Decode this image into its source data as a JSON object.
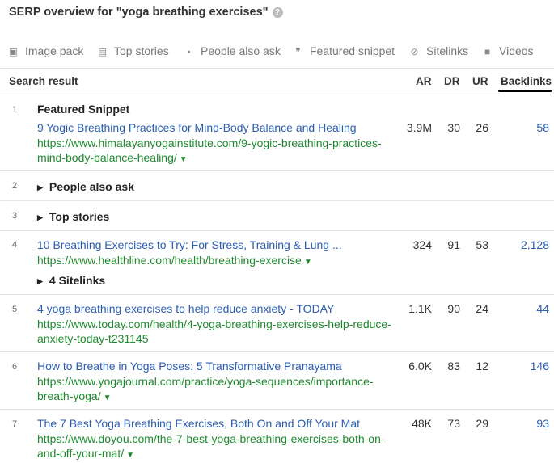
{
  "page_title": "SERP overview for \"yoga breathing exercises\"",
  "features": [
    {
      "icon": "image-icon",
      "glyph": "▣",
      "label": "Image pack"
    },
    {
      "icon": "news-icon",
      "glyph": "▤",
      "label": "Top stories"
    },
    {
      "icon": "question-icon",
      "glyph": "▪",
      "label": "People also ask"
    },
    {
      "icon": "quote-icon",
      "glyph": "❞",
      "label": "Featured snippet"
    },
    {
      "icon": "link-icon",
      "glyph": "⊘",
      "label": "Sitelinks"
    },
    {
      "icon": "video-icon",
      "glyph": "■",
      "label": "Videos"
    }
  ],
  "columns": {
    "result": "Search result",
    "ar": "AR",
    "dr": "DR",
    "ur": "UR",
    "backlinks": "Backlinks"
  },
  "rows": [
    {
      "num": "1",
      "heading": "Featured Snippet",
      "title": "9 Yogic Breathing Practices for Mind-Body Balance and Healing",
      "url": "https://www.himalayanyogainstitute.com/9-yogic-breathing-practices-mind-body-balance-healing/",
      "ar": "3.9M",
      "dr": "30",
      "ur": "26",
      "backlinks": "58"
    },
    {
      "num": "2",
      "label": "People also ask"
    },
    {
      "num": "3",
      "label": "Top stories"
    },
    {
      "num": "4",
      "title": "10 Breathing Exercises to Try: For Stress, Training & Lung ...",
      "url": "https://www.healthline.com/health/breathing-exercise",
      "sitelinks": "4 Sitelinks",
      "ar": "324",
      "dr": "91",
      "ur": "53",
      "backlinks": "2,128"
    },
    {
      "num": "5",
      "title": "4 yoga breathing exercises to help reduce anxiety - TODAY",
      "url": "https://www.today.com/health/4-yoga-breathing-exercises-help-reduce-anxiety-today-t231145",
      "ar": "1.1K",
      "dr": "90",
      "ur": "24",
      "backlinks": "44"
    },
    {
      "num": "6",
      "title": "How to Breathe in Yoga Poses: 5 Transformative Pranayama",
      "url": "https://www.yogajournal.com/practice/yoga-sequences/importance-breath-yoga/",
      "ar": "6.0K",
      "dr": "83",
      "ur": "12",
      "backlinks": "146"
    },
    {
      "num": "7",
      "title": "The 7 Best Yoga Breathing Exercises, Both On and Off Your Mat",
      "url": "https://www.doyou.com/the-7-best-yoga-breathing-exercises-both-on-and-off-your-mat/",
      "ar": "48K",
      "dr": "73",
      "ur": "29",
      "backlinks": "93"
    }
  ]
}
